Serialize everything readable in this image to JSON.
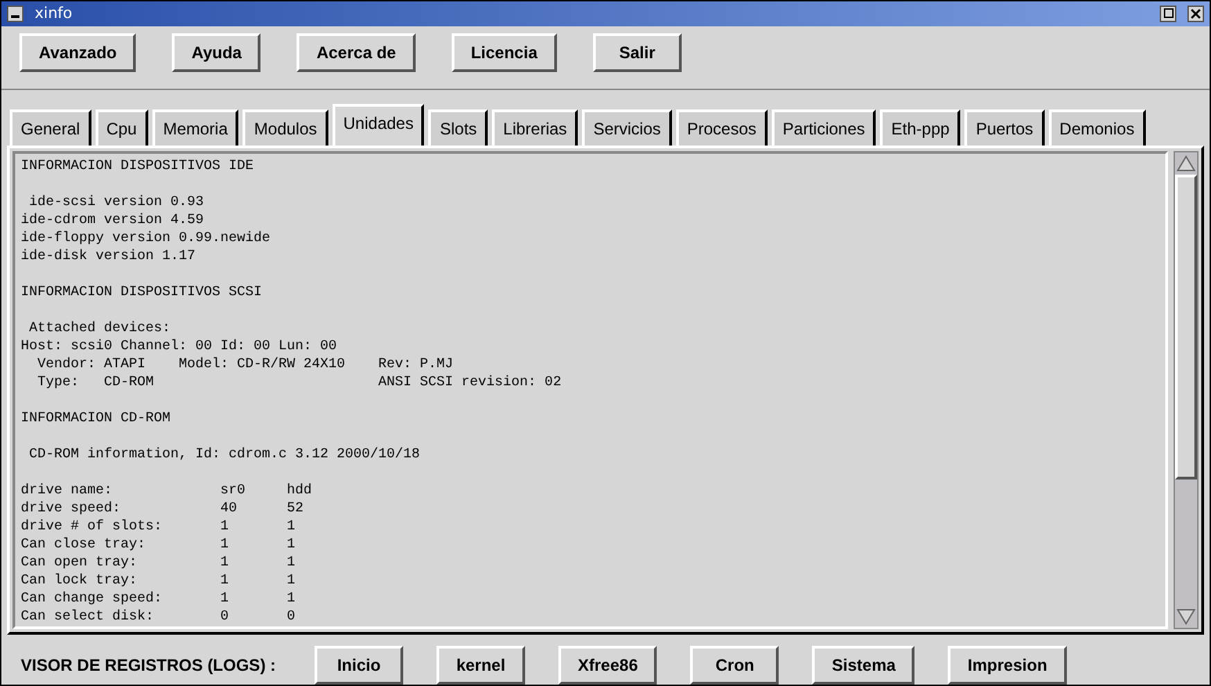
{
  "window": {
    "title": "xinfo"
  },
  "toolbar": {
    "buttons": [
      "Avanzado",
      "Ayuda",
      "Acerca de",
      "Licencia",
      "Salir"
    ]
  },
  "tabs": [
    {
      "label": "General",
      "selected": false
    },
    {
      "label": "Cpu",
      "selected": false
    },
    {
      "label": "Memoria",
      "selected": false
    },
    {
      "label": "Modulos",
      "selected": false
    },
    {
      "label": "Unidades",
      "selected": true
    },
    {
      "label": "Slots",
      "selected": false
    },
    {
      "label": "Librerias",
      "selected": false
    },
    {
      "label": "Servicios",
      "selected": false
    },
    {
      "label": "Procesos",
      "selected": false
    },
    {
      "label": "Particiones",
      "selected": false
    },
    {
      "label": "Eth-ppp",
      "selected": false
    },
    {
      "label": "Puertos",
      "selected": false
    },
    {
      "label": "Demonios",
      "selected": false
    }
  ],
  "output": {
    "blocks": [
      [
        "INFORMACION DISPOSITIVOS IDE"
      ],
      [
        " ide-scsi version 0.93",
        "ide-cdrom version 4.59",
        "ide-floppy version 0.99.newide",
        "ide-disk version 1.17"
      ],
      [
        "INFORMACION DISPOSITIVOS SCSI"
      ],
      [
        " Attached devices:",
        "Host: scsi0 Channel: 00 Id: 00 Lun: 00",
        "  Vendor: ATAPI    Model: CD-R/RW 24X10    Rev: P.MJ",
        "  Type:   CD-ROM                           ANSI SCSI revision: 02"
      ],
      [
        "INFORMACION CD-ROM"
      ],
      [
        " CD-ROM information, Id: cdrom.c 3.12 2000/10/18"
      ],
      [
        "drive name:             sr0     hdd",
        "drive speed:            40      52",
        "drive # of slots:       1       1",
        "Can close tray:         1       1",
        "Can open tray:          1       1",
        "Can lock tray:          1       1",
        "Can change speed:       1       1",
        "Can select disk:        0       0"
      ]
    ]
  },
  "logs_bar": {
    "label": "VISOR DE REGISTROS (LOGS) :",
    "buttons": [
      "Inicio",
      "kernel",
      "Xfree86",
      "Cron",
      "Sistema",
      "Impresion"
    ]
  }
}
